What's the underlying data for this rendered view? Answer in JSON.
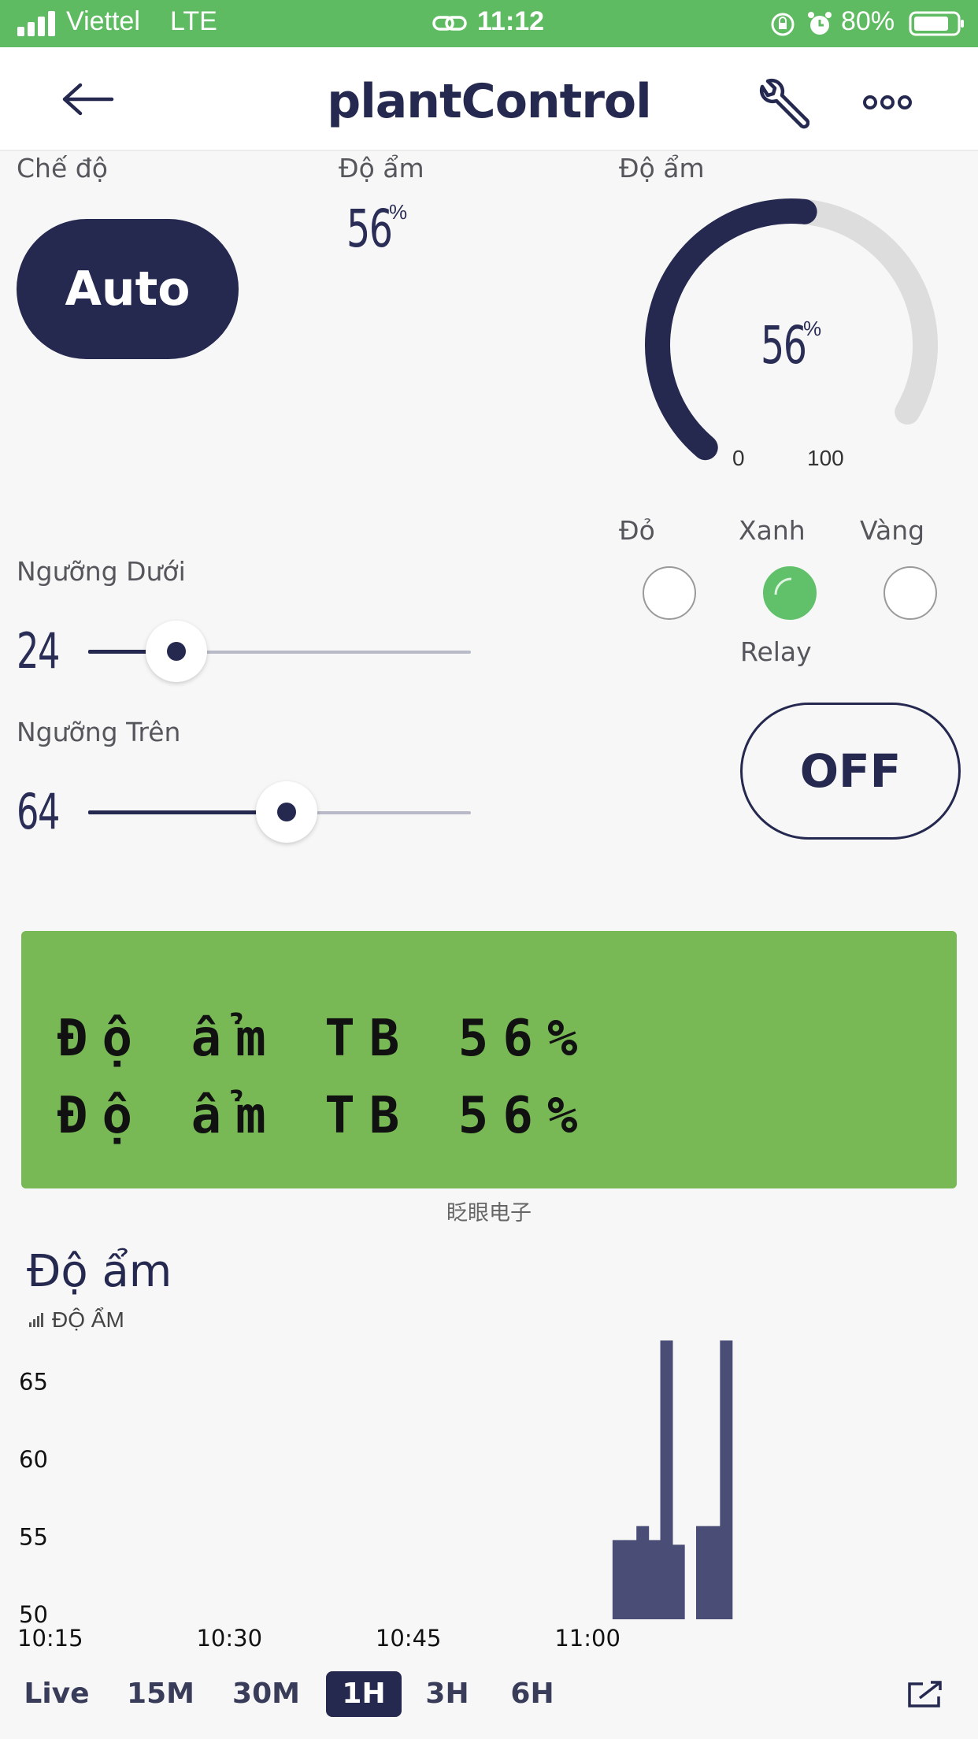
{
  "status_bar": {
    "carrier": "Viettel",
    "network": "LTE",
    "time": "11:12",
    "battery": "80%",
    "icons": [
      "signal-icon",
      "link-icon",
      "rotation-lock-icon",
      "alarm-icon",
      "battery-icon"
    ]
  },
  "header": {
    "title": "plantControl",
    "icons": [
      "back-arrow-icon",
      "wrench-icon",
      "more-icon"
    ]
  },
  "mode": {
    "label": "Chế độ",
    "button": "Auto"
  },
  "humidity_value": {
    "label": "Độ ẩm",
    "value": "56",
    "unit": "%"
  },
  "gauge": {
    "label": "Độ ẩm",
    "value": "56",
    "unit": "%",
    "min": "0",
    "max": "100",
    "level": 56,
    "colors": {
      "fill": "#25284f",
      "track": "#dddddd"
    }
  },
  "leds": {
    "items": [
      {
        "label": "Đỏ",
        "on": false
      },
      {
        "label": "Xanh",
        "on": true
      },
      {
        "label": "Vàng",
        "on": false
      }
    ],
    "on_color": "#60c16a"
  },
  "relay": {
    "label": "Relay",
    "button": "OFF"
  },
  "threshold_low": {
    "label": "Ngưỡng Dưới",
    "value": "24",
    "level": 0.24
  },
  "threshold_high": {
    "label": "Ngưỡng Trên",
    "value": "64",
    "level": 0.64
  },
  "lcd": {
    "line1": "Độ ẩm TB 56%",
    "line2": "Độ ẩm TB 56%",
    "caption": "眨眼电子",
    "background": "#78b956"
  },
  "chart_section": {
    "title": "Độ ẩm",
    "legend": "ĐỘ ẨM",
    "tabs": [
      "Live",
      "15M",
      "30M",
      "1H",
      "3H",
      "6H"
    ],
    "active_tab": "1H",
    "icons": [
      "bars-icon",
      "export-icon"
    ]
  },
  "chart_data": {
    "type": "bar",
    "xlabel": "",
    "ylabel": "",
    "x_ticks": [
      "10:15",
      "10:30",
      "10:45",
      "11:00"
    ],
    "y_ticks": [
      50,
      55,
      60,
      65
    ],
    "ylim": [
      50,
      67
    ],
    "xlim_minutes_past_10": [
      15,
      75
    ],
    "grid": false,
    "bar_color": "#4a4e77",
    "series": [
      {
        "x": [
          "11:03",
          "11:04",
          "11:05",
          "11:06",
          "11:07",
          "11:08",
          "11:10",
          "11:11",
          "11:12"
        ],
        "values": [
          54.8,
          54.8,
          55.7,
          54.8,
          67.8,
          54.5,
          55.7,
          55.7,
          67.8
        ]
      }
    ]
  }
}
